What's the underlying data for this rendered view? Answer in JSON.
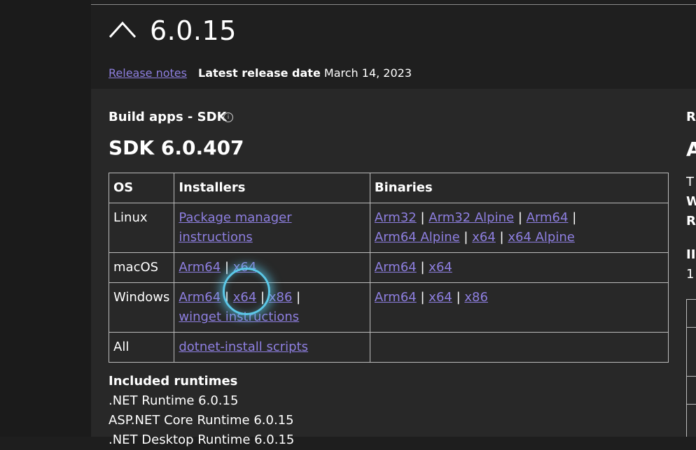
{
  "header": {
    "version": "6.0.15",
    "release_notes_label": "Release notes",
    "latest_release_label": "Latest release date",
    "latest_release_date": "March 14, 2023"
  },
  "sdk": {
    "section_title": "Build apps - SDK",
    "info_icon": "i",
    "title": "SDK 6.0.407",
    "columns": [
      "OS",
      "Installers",
      "Binaries"
    ],
    "rows": {
      "linux": {
        "os": "Linux",
        "installers": [
          "Package manager instructions"
        ],
        "binaries": [
          "Arm32",
          "Arm32 Alpine",
          "Arm64",
          "Arm64 Alpine",
          "x64",
          "x64 Alpine"
        ]
      },
      "macos": {
        "os": "macOS",
        "installers": [
          "Arm64",
          "x64"
        ],
        "binaries": [
          "Arm64",
          "x64"
        ]
      },
      "windows": {
        "os": "Windows",
        "installers": [
          "Arm64",
          "x64",
          "x86",
          "winget instructions"
        ],
        "binaries": [
          "Arm64",
          "x64",
          "x86"
        ]
      },
      "all": {
        "os": "All",
        "installers": [
          "dotnet-install scripts"
        ],
        "binaries": []
      }
    },
    "separator": "|"
  },
  "included_runtimes": {
    "heading": "Included runtimes",
    "items": [
      ".NET Runtime 6.0.15",
      "ASP.NET Core Runtime 6.0.15",
      ".NET Desktop Runtime 6.0.15"
    ]
  },
  "right_column": {
    "fragments": [
      "R",
      "A",
      "T",
      "W",
      "R",
      "II",
      "1"
    ]
  },
  "colors": {
    "link": "#8e7fe0",
    "background": "#282828",
    "header_bg": "#1f1f1f",
    "cursor_highlight": "#5bc8e8"
  }
}
